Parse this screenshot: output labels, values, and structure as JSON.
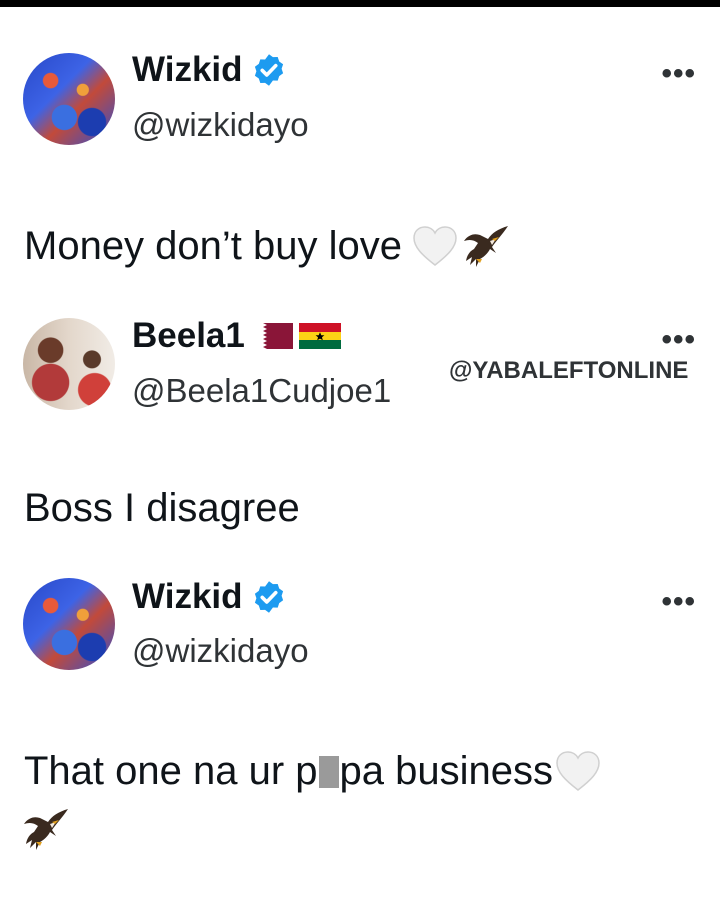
{
  "tweets": [
    {
      "display_name": "Wizkid",
      "handle": "@wizkidayo",
      "text": "Money don’t buy love",
      "more_label": "•••",
      "verified": true
    },
    {
      "display_name": "Beela1",
      "handle": "@Beela1Cudjoe1",
      "text": "Boss I disagree",
      "more_label": "•••",
      "flags": [
        "qatar-flag-icon",
        "ghana-flag-icon"
      ]
    },
    {
      "display_name": "Wizkid",
      "handle": "@wizkidayo",
      "text_before": "That one na ur p",
      "text_after": "pa business",
      "more_label": "•••",
      "verified": true
    }
  ],
  "watermark": "@YABALEFTONLINE",
  "colors": {
    "verified_blue": "#1d9bf0",
    "text": "#0f1419",
    "secondary": "#2f3336"
  }
}
